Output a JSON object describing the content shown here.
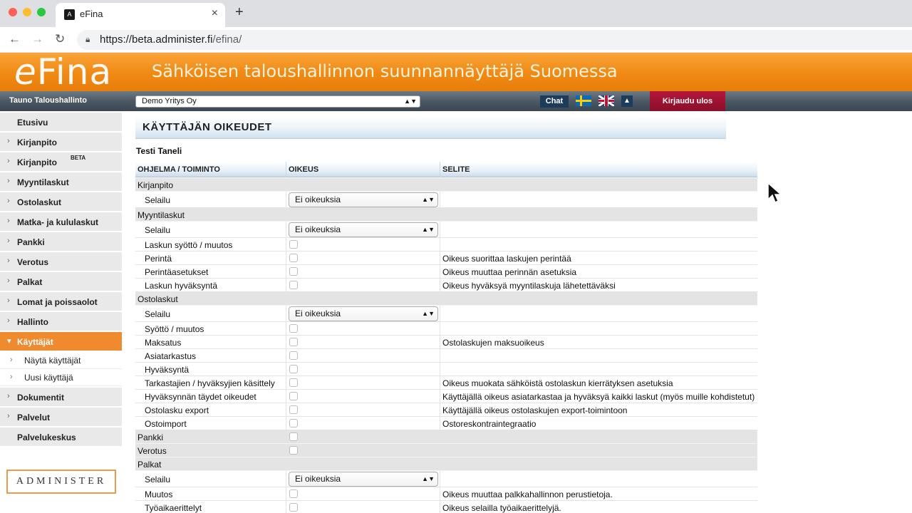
{
  "browser": {
    "tab_title": "eFina",
    "favicon_letter": "A",
    "url_host": "https://beta.administer.fi",
    "url_path": "/efina/"
  },
  "banner": {
    "logo_e": "e",
    "logo_rest": "Fina",
    "tagline": "Sähköisen taloushallinnon suunnannäyttäjä Suomessa"
  },
  "topbar": {
    "user_name": "Tauno Taloushallinto",
    "company": "Demo Yritys Oy",
    "chat_label": "Chat",
    "up_icon": "arrow-up-icon",
    "logout_label": "Kirjaudu ulos"
  },
  "sidebar": {
    "items": [
      {
        "label": "Etusivu",
        "chevron": false
      },
      {
        "label": "Kirjanpito",
        "chevron": true
      },
      {
        "label": "Kirjanpito",
        "badge": "BETA",
        "chevron": true
      },
      {
        "label": "Myyntilaskut",
        "chevron": true
      },
      {
        "label": "Ostolaskut",
        "chevron": true
      },
      {
        "label": "Matka- ja kululaskut",
        "chevron": true
      },
      {
        "label": "Pankki",
        "chevron": true
      },
      {
        "label": "Verotus",
        "chevron": true
      },
      {
        "label": "Palkat",
        "chevron": true
      },
      {
        "label": "Lomat ja poissaolot",
        "chevron": true
      },
      {
        "label": "Hallinto",
        "chevron": true
      },
      {
        "label": "Käyttäjät",
        "chevron": true,
        "active": true
      }
    ],
    "subitems": [
      {
        "label": "Näytä käyttäjät"
      },
      {
        "label": "Uusi käyttäjä"
      }
    ],
    "items_after": [
      {
        "label": "Dokumentit",
        "chevron": true
      },
      {
        "label": "Palvelut",
        "chevron": true
      },
      {
        "label": "Palvelukeskus",
        "chevron": false
      }
    ],
    "logo_text": "ADMINISTER",
    "active_color": "#ef8a2e"
  },
  "main": {
    "page_title": "KÄYTTÄJÄN OIKEUDET",
    "user_heading": "Testi Taneli",
    "columns": [
      "OHJELMA / TOIMINTO",
      "OIKEUS",
      "SELITE"
    ],
    "rows": [
      {
        "type": "section",
        "name": "Kirjanpito"
      },
      {
        "type": "select",
        "name": "Selailu",
        "value": "Ei oikeuksia"
      },
      {
        "type": "section",
        "name": "Myyntilaskut"
      },
      {
        "type": "select",
        "name": "Selailu",
        "value": "Ei oikeuksia"
      },
      {
        "type": "check",
        "name": "Laskun syöttö / muutos",
        "desc": ""
      },
      {
        "type": "check",
        "name": "Perintä",
        "desc": "Oikeus suorittaa laskujen perintää"
      },
      {
        "type": "check",
        "name": "Perintäasetukset",
        "desc": "Oikeus muuttaa perinnän asetuksia"
      },
      {
        "type": "check",
        "name": "Laskun hyväksyntä",
        "desc": "Oikeus hyväksyä myyntilaskuja lähetettäväksi"
      },
      {
        "type": "section",
        "name": "Ostolaskut"
      },
      {
        "type": "select",
        "name": "Selailu",
        "value": "Ei oikeuksia"
      },
      {
        "type": "check",
        "name": "Syöttö / muutos",
        "desc": ""
      },
      {
        "type": "check",
        "name": "Maksatus",
        "desc": "Ostolaskujen maksuoikeus"
      },
      {
        "type": "check",
        "name": "Asiatarkastus",
        "desc": ""
      },
      {
        "type": "check",
        "name": "Hyväksyntä",
        "desc": ""
      },
      {
        "type": "check",
        "name": "Tarkastajien / hyväksyjien käsittely",
        "desc": "Oikeus muokata sähköistä ostolaskun kierrätyksen asetuksia"
      },
      {
        "type": "check",
        "name": "Hyväksynnän täydet oikeudet",
        "desc": "Käyttäjällä oikeus asiatarkastaa ja hyväksyä kaikki laskut (myös muille kohdistetut)"
      },
      {
        "type": "check",
        "name": "Ostolasku export",
        "desc": "Käyttäjällä oikeus ostolaskujen export-toimintoon"
      },
      {
        "type": "check",
        "name": "Ostoimport",
        "desc": "Ostoreskontraintegraatio"
      },
      {
        "type": "section-check",
        "name": "Pankki"
      },
      {
        "type": "section-check",
        "name": "Verotus"
      },
      {
        "type": "section",
        "name": "Palkat"
      },
      {
        "type": "select",
        "name": "Selailu",
        "value": "Ei oikeuksia"
      },
      {
        "type": "check",
        "name": "Muutos",
        "desc": "Oikeus muuttaa palkkahallinnon perustietoja."
      },
      {
        "type": "check",
        "name": "Työaikaerittelyt",
        "desc": "Oikeus selailla työaikaerittelyjä."
      }
    ]
  }
}
